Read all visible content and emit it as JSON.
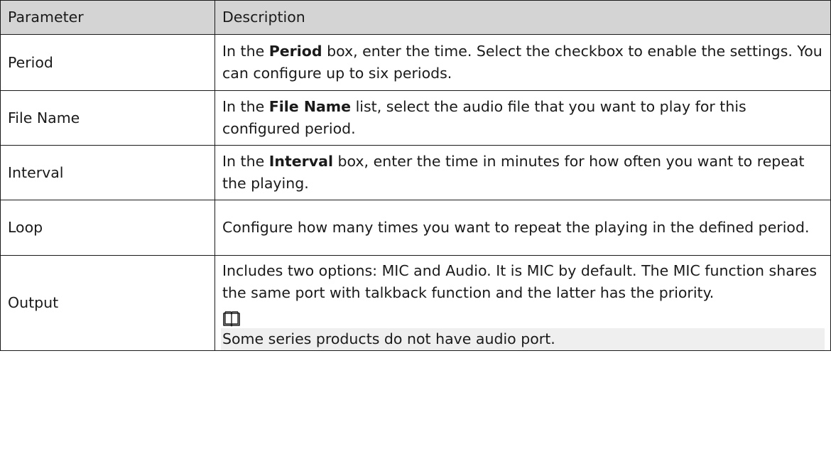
{
  "table": {
    "headers": {
      "parameter": "Parameter",
      "description": "Description"
    },
    "rows": [
      {
        "parameter": "Period",
        "description_parts": [
          "In the ",
          "Period",
          " box, enter the time. Select the checkbox to enable the settings. You can configure up to six periods."
        ]
      },
      {
        "parameter": "File Name",
        "description_parts": [
          "In the ",
          "File Name",
          " list, select the audio file that you want to play for this configured period."
        ]
      },
      {
        "parameter": "Interval",
        "description_parts": [
          "In the ",
          "Interval",
          " box, enter the time in minutes for how often you want to repeat the playing."
        ]
      },
      {
        "parameter": "Loop",
        "description": "Configure how many times you want to repeat the playing in the defined period."
      },
      {
        "parameter": "Output",
        "description": "Includes two options: MIC and Audio. It is MIC by default. The MIC function shares the same port with talkback function and the latter has the priority.",
        "note_icon": "book-icon",
        "note": "Some series products do not have audio port."
      }
    ]
  }
}
